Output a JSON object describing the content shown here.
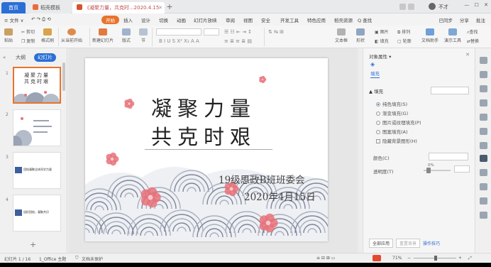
{
  "titlebar": {
    "tabs": [
      {
        "label": "首页"
      },
      {
        "label": "稻壳模板"
      },
      {
        "label": "《凝聚力量，共克时...2020.4.15"
      }
    ],
    "user": "不才"
  },
  "menubar": {
    "file": "≡ 文件 ∨",
    "items": [
      "开始",
      "插入",
      "设计",
      "切换",
      "动画",
      "幻灯片放映",
      "审阅",
      "视图",
      "安全",
      "开发工具",
      "特色应用",
      "稻壳资源",
      "Q 查找"
    ],
    "right": [
      "已同步",
      "分享",
      "批注"
    ]
  },
  "ribbon": {
    "paste": "粘贴",
    "cut": "剪切",
    "copy": "复制",
    "format_painter": "格式刷",
    "play_from_current": "从当前开始",
    "new_slide": "新建幻灯片",
    "layout": "版式",
    "section": "节",
    "textbox": "文本框",
    "shape": "形状",
    "picture": "图片",
    "fill": "填充",
    "arrange": "排列",
    "outline": "轮廓",
    "find": "查找",
    "replace": "替换",
    "select": "选择",
    "doc_assistant": "文档助手",
    "presentation_tools": "演示工具"
  },
  "leftpanel": {
    "outline_label": "大纲",
    "slides_label": "幻灯片",
    "thumb_numbers": [
      "1",
      "2",
      "3",
      "4"
    ],
    "thumb1_title": "凝聚力量\n共克时艰",
    "thumb3_text": "团结凝聚全体同学力量",
    "thumb4_text": "组织团结，凝聚共识"
  },
  "slide": {
    "title_line1": "凝聚力量",
    "title_line2": "共克时艰",
    "subtitle1": "19级思政B班班委会",
    "subtitle2": "2020年4月15日",
    "colors": {
      "wave": "#a9b0bf",
      "wave_dark": "#7e8699",
      "blossom": "#e8727a"
    }
  },
  "rightpanel": {
    "title": "对象属性 ▾",
    "tab_fill": "填充",
    "fill_section": "▲ 填充",
    "options": [
      {
        "label": "纯色填充(S)",
        "checked": true
      },
      {
        "label": "渐变填充(G)",
        "checked": false
      },
      {
        "label": "图片或纹理填充(P)",
        "checked": false
      },
      {
        "label": "图案填充(A)",
        "checked": false
      }
    ],
    "hide_background": "隐藏背景图形(H)",
    "color_label": "颜色(C)",
    "transparency_label": "透明度(T)",
    "transparency_value": "0%",
    "apply_all": "全部应用",
    "reset_background": "重置背景",
    "tips": "操作技巧"
  },
  "statusbar": {
    "slide_counter": "幻灯片 1 / 16",
    "theme": "1_Office 主题",
    "protection": "文档未保护",
    "zoom": "71%"
  }
}
